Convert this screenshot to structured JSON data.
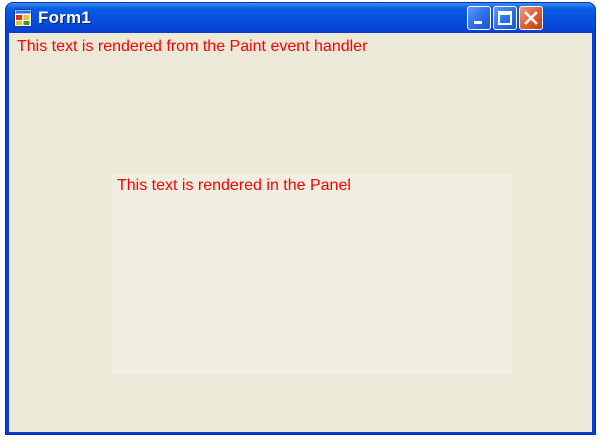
{
  "window": {
    "title": "Form1",
    "icon": "app-window-icon",
    "controls": [
      "minimize-icon",
      "maximize-icon",
      "close-icon"
    ]
  },
  "canvas": {
    "paint_text": "This text is rendered from the Paint event handler"
  },
  "panel": {
    "text": "This text is rendered in the Panel"
  },
  "colors": {
    "titlebar": "#0553e0",
    "client_background": "#ece9d8",
    "panel_background": "#f2efe2",
    "text": "#ff0000",
    "close_button": "#e25f32"
  }
}
